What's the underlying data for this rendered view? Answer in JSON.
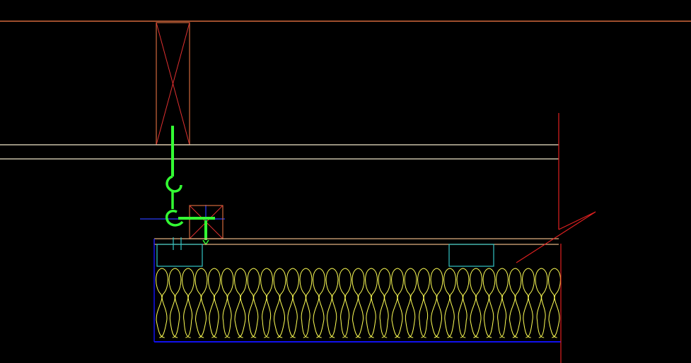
{
  "drawing": {
    "background": "#000000",
    "layer_colors": {
      "timber": "#d2693c",
      "ceiling_lines": "#f0e6c8",
      "hanger": "#33ff33",
      "crosshair": "#2233cc",
      "board": "#e0b080",
      "insulation": "#ffff55",
      "frame": "#1111ee",
      "clip": "#33c4c4",
      "break_line": "#e02020"
    },
    "components": [
      "joist-section",
      "ceiling-lines",
      "hook-hanger",
      "batten-section",
      "plasterboard",
      "batt-insulation",
      "break-line"
    ]
  }
}
